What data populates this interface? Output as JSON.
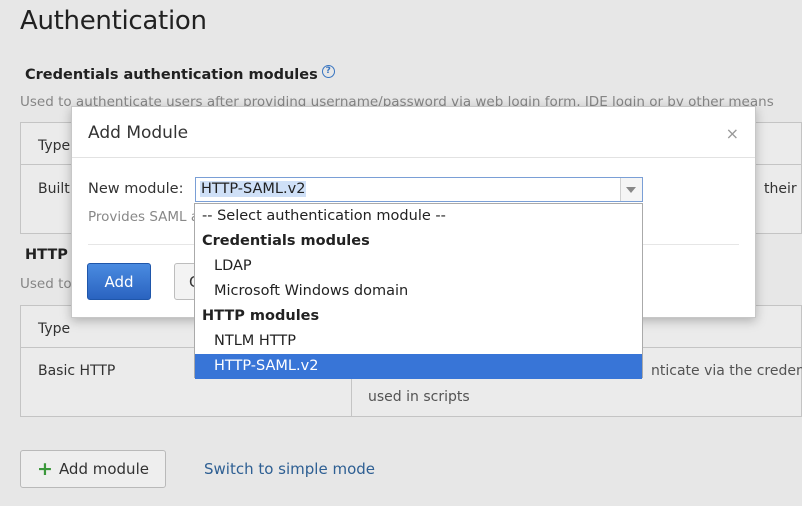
{
  "page": {
    "title": "Authentication"
  },
  "credentials_section": {
    "title": "Credentials authentication modules",
    "description": "Used to authenticate users after providing username/password via web login form, IDE login or by other means",
    "table": {
      "header_type": "Type",
      "row1_type": "Built",
      "right_fragment": "their pa"
    }
  },
  "http_section": {
    "title": "HTTP",
    "description": "Used to",
    "table": {
      "header_type": "Type",
      "row_type": "Basic HTTP",
      "row_desc_line1": "nticate via the credential",
      "row_desc_line2": "used in scripts"
    }
  },
  "footer": {
    "add_module_label": "Add module",
    "switch_link": "Switch to simple mode"
  },
  "modal": {
    "title": "Add Module",
    "close_glyph": "×",
    "field_label": "New module:",
    "selected_value": "HTTP-SAML.v2",
    "description": "Provides SAML a",
    "add_label": "Add",
    "cancel_fragment": "C"
  },
  "dropdown": {
    "placeholder": "-- Select authentication module --",
    "groups": [
      {
        "label": "Credentials modules",
        "options": [
          "LDAP",
          "Microsoft Windows domain"
        ]
      },
      {
        "label": "HTTP modules",
        "options": [
          "NTLM HTTP",
          "HTTP-SAML.v2"
        ]
      }
    ],
    "selected": "HTTP-SAML.v2"
  },
  "colors": {
    "accent": "#3875d7",
    "primary_button": "#2a63c0",
    "link": "#2f6196",
    "add_icon": "#3d9b3d"
  },
  "icons": {
    "help": "question-circle-icon",
    "close": "close-icon",
    "add": "plus-icon",
    "dropdown_arrow": "chevron-down-icon"
  }
}
